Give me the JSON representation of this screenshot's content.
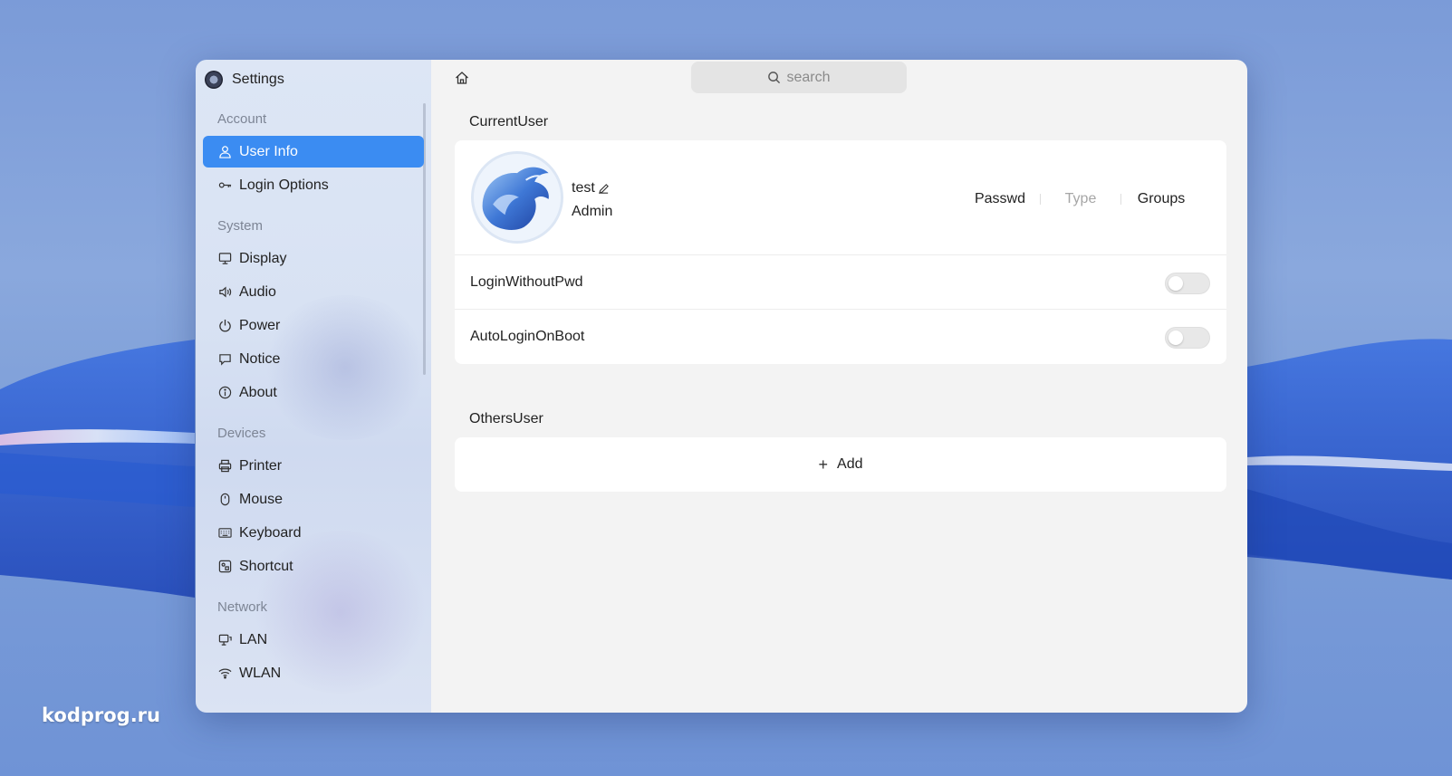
{
  "watermark": "kodprog.ru",
  "window": {
    "app_title": "Settings",
    "search_placeholder": "search"
  },
  "sidebar": {
    "groups": [
      {
        "title": "Account",
        "items": [
          {
            "label": "User Info",
            "icon": "user-icon",
            "active": true
          },
          {
            "label": "Login Options",
            "icon": "key-icon"
          }
        ]
      },
      {
        "title": "System",
        "items": [
          {
            "label": "Display",
            "icon": "monitor-icon"
          },
          {
            "label": "Audio",
            "icon": "speaker-icon"
          },
          {
            "label": "Power",
            "icon": "power-icon"
          },
          {
            "label": "Notice",
            "icon": "message-icon"
          },
          {
            "label": "About",
            "icon": "info-icon"
          }
        ]
      },
      {
        "title": "Devices",
        "items": [
          {
            "label": "Printer",
            "icon": "printer-icon"
          },
          {
            "label": "Mouse",
            "icon": "mouse-icon"
          },
          {
            "label": "Keyboard",
            "icon": "keyboard-icon"
          },
          {
            "label": "Shortcut",
            "icon": "shortcut-icon"
          }
        ]
      },
      {
        "title": "Network",
        "items": [
          {
            "label": "LAN",
            "icon": "lan-icon"
          },
          {
            "label": "WLAN",
            "icon": "wifi-icon"
          }
        ]
      }
    ]
  },
  "main": {
    "current_user_label": "CurrentUser",
    "user": {
      "name": "test",
      "role": "Admin",
      "actions": [
        "Passwd",
        "Type",
        "Groups"
      ]
    },
    "toggles": [
      {
        "label": "LoginWithoutPwd",
        "on": false
      },
      {
        "label": "AutoLoginOnBoot",
        "on": false
      }
    ],
    "others_user_label": "OthersUser",
    "add_label": "Add"
  },
  "colors": {
    "accent": "#3b8cf2",
    "content_bg": "#f3f3f3",
    "sidebar_bg": "#d8e2f3"
  }
}
